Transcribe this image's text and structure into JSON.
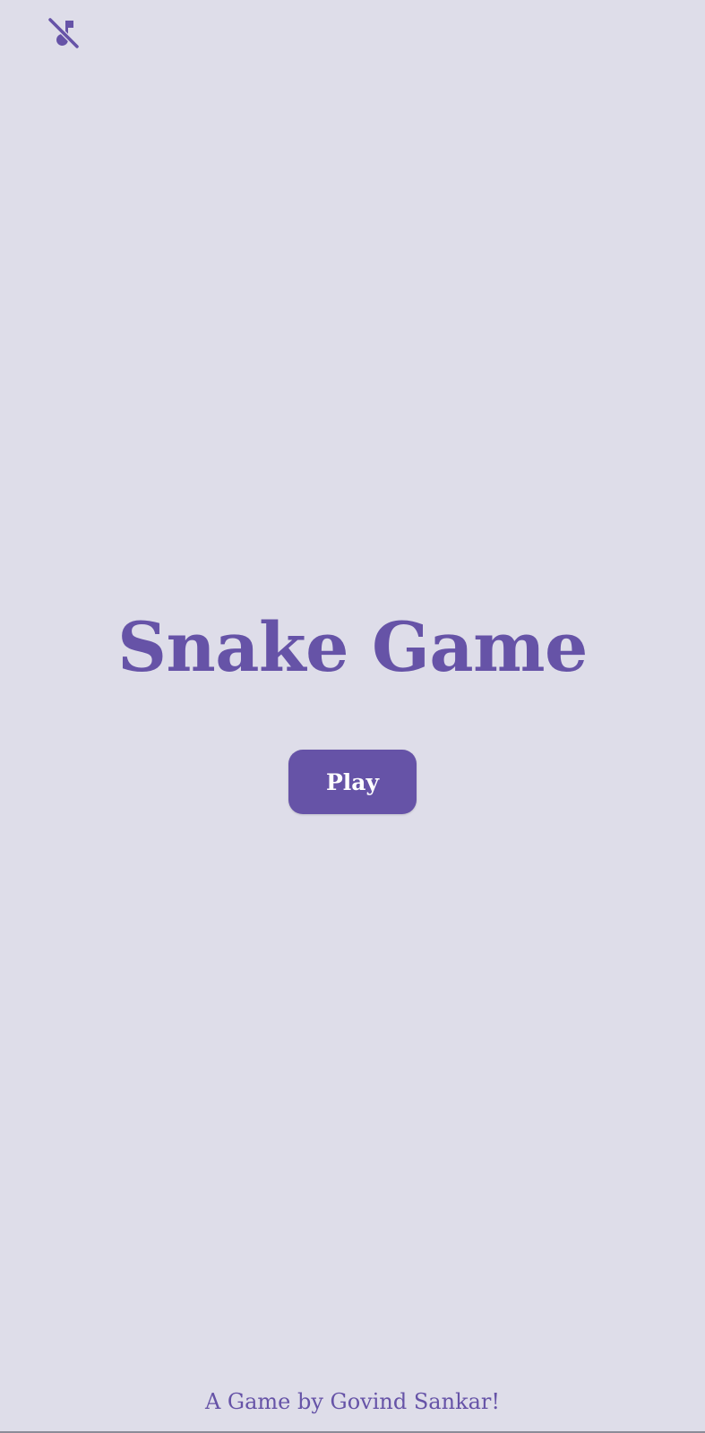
{
  "screen": {
    "background_color": "#dedde9",
    "accent_color": "#6653a7"
  },
  "music_toggle": {
    "icon": "music-off-icon",
    "state": "muted"
  },
  "title": "Snake Game",
  "play_button": {
    "label": "Play"
  },
  "credit": "A Game by Govind Sankar!"
}
